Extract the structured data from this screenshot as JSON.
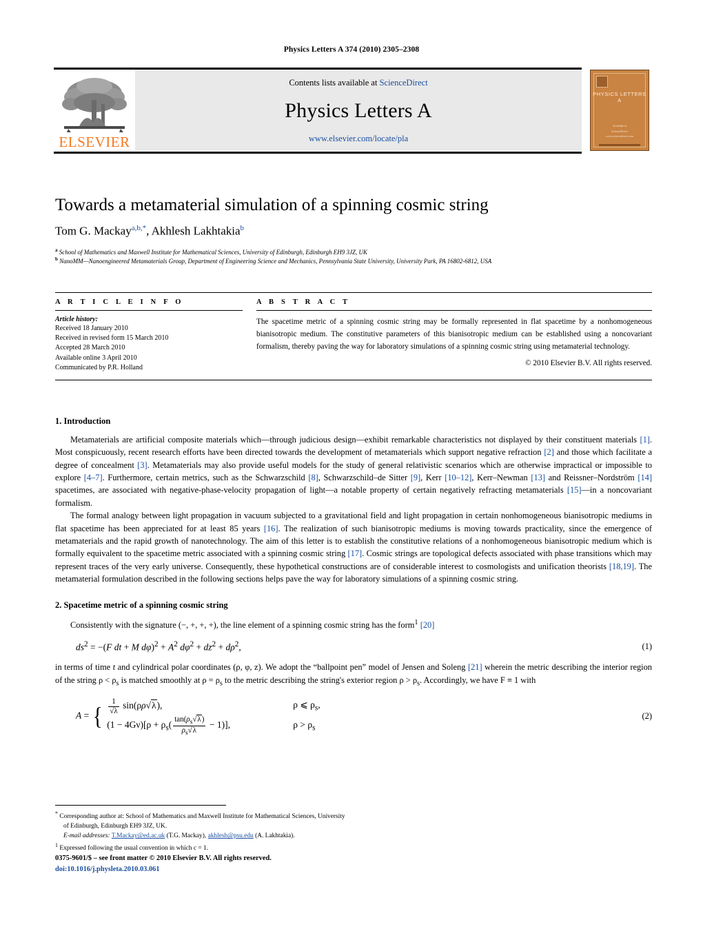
{
  "running_head": "Physics Letters A 374 (2010) 2305–2308",
  "masthead": {
    "contents_prefix": "Contents lists available at ",
    "sciencedirect": "ScienceDirect",
    "journal_title": "Physics Letters A",
    "journal_url": "www.elsevier.com/locate/pla",
    "publisher_wordmark": "ELSEVIER",
    "publisher_color": "#F47920",
    "link_color": "#1a4fa0",
    "cover": {
      "title": "PHYSICS LETTERS A",
      "foot_line1": "Available at",
      "foot_line2": "ScienceDirect",
      "foot_line3": "www.sciencedirect.com"
    }
  },
  "article": {
    "title": "Towards a metamaterial simulation of a spinning cosmic string",
    "authors": [
      {
        "name": "Tom G. Mackay",
        "marks": "a,b,*"
      },
      {
        "name": "Akhlesh Lakhtakia",
        "marks": "b"
      }
    ],
    "affiliations": [
      {
        "mark": "a",
        "text": "School of Mathematics and Maxwell Institute for Mathematical Sciences, University of Edinburgh, Edinburgh EH9 3JZ, UK"
      },
      {
        "mark": "b",
        "text": "NanoMM—Nanoengineered Metamaterials Group, Department of Engineering Science and Mechanics, Pennsylvania State University, University Park, PA 16802-6812, USA"
      }
    ]
  },
  "info": {
    "kicker": "A R T I C L E    I N F O",
    "history_label": "Article history:",
    "history": [
      "Received 18 January 2010",
      "Received in revised form 15 March 2010",
      "Accepted 28 March 2010",
      "Available online 3 April 2010",
      "Communicated by P.R. Holland"
    ]
  },
  "abstract": {
    "kicker": "A B S T R A C T",
    "text": "The spacetime metric of a spinning cosmic string may be formally represented in flat spacetime by a nonhomogeneous bianisotropic medium. The constitutive parameters of this bianisotropic medium can be established using a noncovariant formalism, thereby paving the way for laboratory simulations of a spinning cosmic string using metamaterial technology.",
    "copyright": "© 2010 Elsevier B.V. All rights reserved."
  },
  "sections": [
    {
      "heading": "1. Introduction"
    },
    {
      "heading": "2. Spacetime metric of a spinning cosmic string"
    }
  ],
  "paragraphs": {
    "intro_1": {
      "part1": "Metamaterials are artificial composite materials which—through judicious design—exhibit remarkable characteristics not displayed by their constituent materials ",
      "r1": "[1]",
      "part2": ". Most conspicuously, recent research efforts have been directed towards the development of metamaterials which support negative refraction ",
      "r2": "[2]",
      "part3": " and those which facilitate a degree of concealment ",
      "r3": "[3]",
      "part4": ". Metamaterials may also provide useful models for the study of general relativistic scenarios which are otherwise impractical or impossible to explore ",
      "r4": "[4–7]",
      "part5": ". Furthermore, certain metrics, such as the Schwarzschild ",
      "r5": "[8]",
      "part6": ", Schwarzschild–de Sitter ",
      "r6": "[9]",
      "part7": ", Kerr ",
      "r7": "[10–12]",
      "part8": ", Kerr–Newman ",
      "r8": "[13]",
      "part9": " and Reissner–Nordström ",
      "r9": "[14]",
      "part10": " spacetimes, are associated with negative-phase-velocity propagation of light—a notable property of certain negatively refracting metamaterials ",
      "r10": "[15]",
      "part11": "—in a noncovariant formalism."
    },
    "intro_2": {
      "part1": "The formal analogy between light propagation in vacuum subjected to a gravitational field and light propagation in certain nonhomogeneous bianisotropic mediums in flat spacetime has been appreciated for at least 85 years ",
      "r1": "[16]",
      "part2": ". The realization of such bianisotropic mediums is moving towards practicality, since the emergence of metamaterials and the rapid growth of nanotechnology. The aim of this letter is to establish the constitutive relations of a nonhomogeneous bianisotropic medium which is formally equivalent to the spacetime metric associated with a spinning cosmic string ",
      "r2": "[17]",
      "part3": ". Cosmic strings are topological defects associated with phase transitions which may represent traces of the very early universe. Consequently, these hypothetical constructions are of considerable interest to cosmologists and unification theorists ",
      "r3": "[18,19]",
      "part4": ". The metamaterial formulation described in the following sections helps pave the way for laboratory simulations of a spinning cosmic string."
    },
    "sec2_1": {
      "part1": "Consistently with the signature (−, +, +, +), the line element of a spinning cosmic string has the form",
      "footnote_mark": "1",
      "part2": " ",
      "r1": "[20]"
    },
    "sec2_2": {
      "part1": "in terms of time ",
      "m1": "t",
      "part2": " and cylindrical polar coordinates (ρ, φ, z). We adopt the “ballpoint pen” model of Jensen and Soleng ",
      "r1": "[21]",
      "part3": " wherein the metric describing the interior region of the string ρ < ρ",
      "part4": " is matched smoothly at ρ = ρ",
      "part5": " to the metric describing the string's exterior region ρ > ρ",
      "part6": ". Accordingly, we have F ≡ 1 with"
    }
  },
  "equations": {
    "eq1": {
      "number": "(1)",
      "lhs": "ds",
      "text": "ds² = −(F dt + M dφ)² + A² dφ² + dz² + dρ²,"
    },
    "eq2": {
      "number": "(2)",
      "lhs": "A",
      "case1_expr_prefix": "sin(ρ",
      "case1_cond": "ρ ⩽ ρ",
      "case2_prefix": "(1 − 4Gν)[ρ + ρ",
      "case2_cond": "ρ > ρ"
    }
  },
  "footnotes": [
    {
      "mark": "*",
      "text_before": "Corresponding author at: School of Mathematics and Maxwell Institute for Mathematical Sciences, University of Edinburgh, Edinburgh EH9 3JZ, UK.",
      "emails_label": "E-mail addresses:",
      "email1": "T.Mackay@ed.ac.uk",
      "email1_owner": "(T.G. Mackay),",
      "email2": "akhlesh@psu.edu",
      "email2_owner": "(A. Lakhtakia)."
    },
    {
      "mark": "1",
      "text_before": "Expressed following the usual convention in which c = 1."
    }
  ],
  "imprint": {
    "line1": "0375-9601/$ – see front matter  © 2010 Elsevier B.V. All rights reserved.",
    "doi": "doi:10.1016/j.physleta.2010.03.061"
  }
}
